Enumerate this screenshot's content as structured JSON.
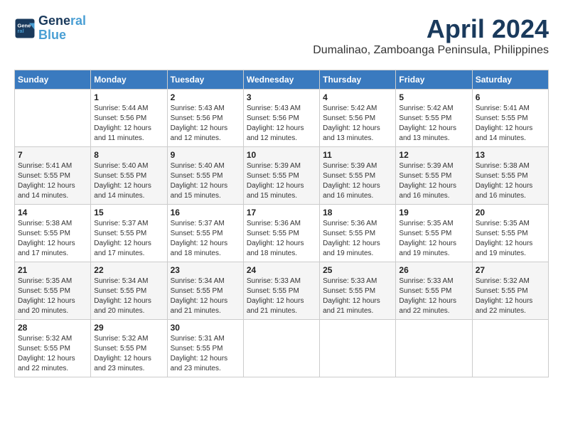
{
  "logo": {
    "line1": "General",
    "line2": "Blue",
    "tagline": ""
  },
  "header": {
    "title": "April 2024",
    "subtitle": "Dumalinao, Zamboanga Peninsula, Philippines"
  },
  "weekdays": [
    "Sunday",
    "Monday",
    "Tuesday",
    "Wednesday",
    "Thursday",
    "Friday",
    "Saturday"
  ],
  "weeks": [
    [
      {
        "day": "",
        "sunrise": "",
        "sunset": "",
        "daylight": ""
      },
      {
        "day": "1",
        "sunrise": "Sunrise: 5:44 AM",
        "sunset": "Sunset: 5:56 PM",
        "daylight": "Daylight: 12 hours and 11 minutes."
      },
      {
        "day": "2",
        "sunrise": "Sunrise: 5:43 AM",
        "sunset": "Sunset: 5:56 PM",
        "daylight": "Daylight: 12 hours and 12 minutes."
      },
      {
        "day": "3",
        "sunrise": "Sunrise: 5:43 AM",
        "sunset": "Sunset: 5:56 PM",
        "daylight": "Daylight: 12 hours and 12 minutes."
      },
      {
        "day": "4",
        "sunrise": "Sunrise: 5:42 AM",
        "sunset": "Sunset: 5:56 PM",
        "daylight": "Daylight: 12 hours and 13 minutes."
      },
      {
        "day": "5",
        "sunrise": "Sunrise: 5:42 AM",
        "sunset": "Sunset: 5:55 PM",
        "daylight": "Daylight: 12 hours and 13 minutes."
      },
      {
        "day": "6",
        "sunrise": "Sunrise: 5:41 AM",
        "sunset": "Sunset: 5:55 PM",
        "daylight": "Daylight: 12 hours and 14 minutes."
      }
    ],
    [
      {
        "day": "7",
        "sunrise": "Sunrise: 5:41 AM",
        "sunset": "Sunset: 5:55 PM",
        "daylight": "Daylight: 12 hours and 14 minutes."
      },
      {
        "day": "8",
        "sunrise": "Sunrise: 5:40 AM",
        "sunset": "Sunset: 5:55 PM",
        "daylight": "Daylight: 12 hours and 14 minutes."
      },
      {
        "day": "9",
        "sunrise": "Sunrise: 5:40 AM",
        "sunset": "Sunset: 5:55 PM",
        "daylight": "Daylight: 12 hours and 15 minutes."
      },
      {
        "day": "10",
        "sunrise": "Sunrise: 5:39 AM",
        "sunset": "Sunset: 5:55 PM",
        "daylight": "Daylight: 12 hours and 15 minutes."
      },
      {
        "day": "11",
        "sunrise": "Sunrise: 5:39 AM",
        "sunset": "Sunset: 5:55 PM",
        "daylight": "Daylight: 12 hours and 16 minutes."
      },
      {
        "day": "12",
        "sunrise": "Sunrise: 5:39 AM",
        "sunset": "Sunset: 5:55 PM",
        "daylight": "Daylight: 12 hours and 16 minutes."
      },
      {
        "day": "13",
        "sunrise": "Sunrise: 5:38 AM",
        "sunset": "Sunset: 5:55 PM",
        "daylight": "Daylight: 12 hours and 16 minutes."
      }
    ],
    [
      {
        "day": "14",
        "sunrise": "Sunrise: 5:38 AM",
        "sunset": "Sunset: 5:55 PM",
        "daylight": "Daylight: 12 hours and 17 minutes."
      },
      {
        "day": "15",
        "sunrise": "Sunrise: 5:37 AM",
        "sunset": "Sunset: 5:55 PM",
        "daylight": "Daylight: 12 hours and 17 minutes."
      },
      {
        "day": "16",
        "sunrise": "Sunrise: 5:37 AM",
        "sunset": "Sunset: 5:55 PM",
        "daylight": "Daylight: 12 hours and 18 minutes."
      },
      {
        "day": "17",
        "sunrise": "Sunrise: 5:36 AM",
        "sunset": "Sunset: 5:55 PM",
        "daylight": "Daylight: 12 hours and 18 minutes."
      },
      {
        "day": "18",
        "sunrise": "Sunrise: 5:36 AM",
        "sunset": "Sunset: 5:55 PM",
        "daylight": "Daylight: 12 hours and 19 minutes."
      },
      {
        "day": "19",
        "sunrise": "Sunrise: 5:35 AM",
        "sunset": "Sunset: 5:55 PM",
        "daylight": "Daylight: 12 hours and 19 minutes."
      },
      {
        "day": "20",
        "sunrise": "Sunrise: 5:35 AM",
        "sunset": "Sunset: 5:55 PM",
        "daylight": "Daylight: 12 hours and 19 minutes."
      }
    ],
    [
      {
        "day": "21",
        "sunrise": "Sunrise: 5:35 AM",
        "sunset": "Sunset: 5:55 PM",
        "daylight": "Daylight: 12 hours and 20 minutes."
      },
      {
        "day": "22",
        "sunrise": "Sunrise: 5:34 AM",
        "sunset": "Sunset: 5:55 PM",
        "daylight": "Daylight: 12 hours and 20 minutes."
      },
      {
        "day": "23",
        "sunrise": "Sunrise: 5:34 AM",
        "sunset": "Sunset: 5:55 PM",
        "daylight": "Daylight: 12 hours and 21 minutes."
      },
      {
        "day": "24",
        "sunrise": "Sunrise: 5:33 AM",
        "sunset": "Sunset: 5:55 PM",
        "daylight": "Daylight: 12 hours and 21 minutes."
      },
      {
        "day": "25",
        "sunrise": "Sunrise: 5:33 AM",
        "sunset": "Sunset: 5:55 PM",
        "daylight": "Daylight: 12 hours and 21 minutes."
      },
      {
        "day": "26",
        "sunrise": "Sunrise: 5:33 AM",
        "sunset": "Sunset: 5:55 PM",
        "daylight": "Daylight: 12 hours and 22 minutes."
      },
      {
        "day": "27",
        "sunrise": "Sunrise: 5:32 AM",
        "sunset": "Sunset: 5:55 PM",
        "daylight": "Daylight: 12 hours and 22 minutes."
      }
    ],
    [
      {
        "day": "28",
        "sunrise": "Sunrise: 5:32 AM",
        "sunset": "Sunset: 5:55 PM",
        "daylight": "Daylight: 12 hours and 22 minutes."
      },
      {
        "day": "29",
        "sunrise": "Sunrise: 5:32 AM",
        "sunset": "Sunset: 5:55 PM",
        "daylight": "Daylight: 12 hours and 23 minutes."
      },
      {
        "day": "30",
        "sunrise": "Sunrise: 5:31 AM",
        "sunset": "Sunset: 5:55 PM",
        "daylight": "Daylight: 12 hours and 23 minutes."
      },
      {
        "day": "",
        "sunrise": "",
        "sunset": "",
        "daylight": ""
      },
      {
        "day": "",
        "sunrise": "",
        "sunset": "",
        "daylight": ""
      },
      {
        "day": "",
        "sunrise": "",
        "sunset": "",
        "daylight": ""
      },
      {
        "day": "",
        "sunrise": "",
        "sunset": "",
        "daylight": ""
      }
    ]
  ]
}
